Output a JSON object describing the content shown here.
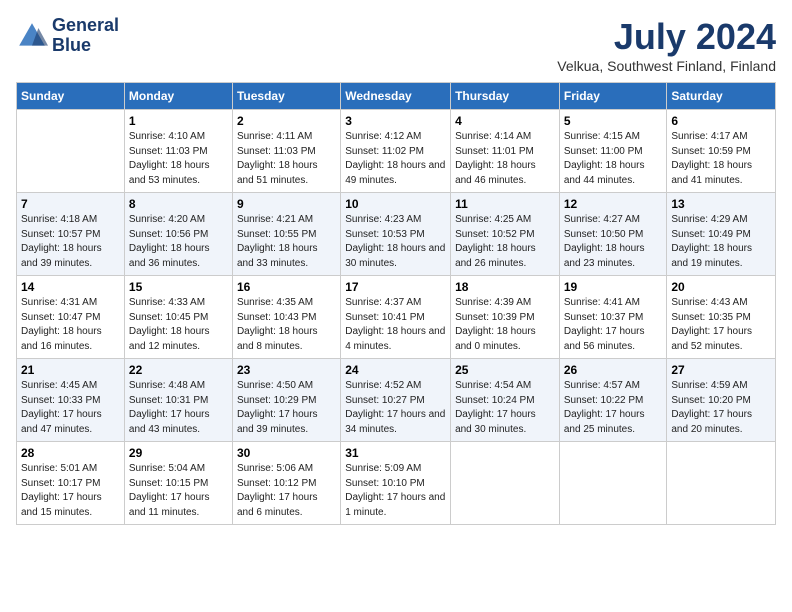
{
  "header": {
    "logo_line1": "General",
    "logo_line2": "Blue",
    "month": "July 2024",
    "location": "Velkua, Southwest Finland, Finland"
  },
  "weekdays": [
    "Sunday",
    "Monday",
    "Tuesday",
    "Wednesday",
    "Thursday",
    "Friday",
    "Saturday"
  ],
  "weeks": [
    [
      {
        "day": "",
        "info": ""
      },
      {
        "day": "1",
        "info": "Sunrise: 4:10 AM\nSunset: 11:03 PM\nDaylight: 18 hours\nand 53 minutes."
      },
      {
        "day": "2",
        "info": "Sunrise: 4:11 AM\nSunset: 11:03 PM\nDaylight: 18 hours\nand 51 minutes."
      },
      {
        "day": "3",
        "info": "Sunrise: 4:12 AM\nSunset: 11:02 PM\nDaylight: 18 hours\nand 49 minutes."
      },
      {
        "day": "4",
        "info": "Sunrise: 4:14 AM\nSunset: 11:01 PM\nDaylight: 18 hours\nand 46 minutes."
      },
      {
        "day": "5",
        "info": "Sunrise: 4:15 AM\nSunset: 11:00 PM\nDaylight: 18 hours\nand 44 minutes."
      },
      {
        "day": "6",
        "info": "Sunrise: 4:17 AM\nSunset: 10:59 PM\nDaylight: 18 hours\nand 41 minutes."
      }
    ],
    [
      {
        "day": "7",
        "info": "Sunrise: 4:18 AM\nSunset: 10:57 PM\nDaylight: 18 hours\nand 39 minutes."
      },
      {
        "day": "8",
        "info": "Sunrise: 4:20 AM\nSunset: 10:56 PM\nDaylight: 18 hours\nand 36 minutes."
      },
      {
        "day": "9",
        "info": "Sunrise: 4:21 AM\nSunset: 10:55 PM\nDaylight: 18 hours\nand 33 minutes."
      },
      {
        "day": "10",
        "info": "Sunrise: 4:23 AM\nSunset: 10:53 PM\nDaylight: 18 hours\nand 30 minutes."
      },
      {
        "day": "11",
        "info": "Sunrise: 4:25 AM\nSunset: 10:52 PM\nDaylight: 18 hours\nand 26 minutes."
      },
      {
        "day": "12",
        "info": "Sunrise: 4:27 AM\nSunset: 10:50 PM\nDaylight: 18 hours\nand 23 minutes."
      },
      {
        "day": "13",
        "info": "Sunrise: 4:29 AM\nSunset: 10:49 PM\nDaylight: 18 hours\nand 19 minutes."
      }
    ],
    [
      {
        "day": "14",
        "info": "Sunrise: 4:31 AM\nSunset: 10:47 PM\nDaylight: 18 hours\nand 16 minutes."
      },
      {
        "day": "15",
        "info": "Sunrise: 4:33 AM\nSunset: 10:45 PM\nDaylight: 18 hours\nand 12 minutes."
      },
      {
        "day": "16",
        "info": "Sunrise: 4:35 AM\nSunset: 10:43 PM\nDaylight: 18 hours\nand 8 minutes."
      },
      {
        "day": "17",
        "info": "Sunrise: 4:37 AM\nSunset: 10:41 PM\nDaylight: 18 hours\nand 4 minutes."
      },
      {
        "day": "18",
        "info": "Sunrise: 4:39 AM\nSunset: 10:39 PM\nDaylight: 18 hours\nand 0 minutes."
      },
      {
        "day": "19",
        "info": "Sunrise: 4:41 AM\nSunset: 10:37 PM\nDaylight: 17 hours\nand 56 minutes."
      },
      {
        "day": "20",
        "info": "Sunrise: 4:43 AM\nSunset: 10:35 PM\nDaylight: 17 hours\nand 52 minutes."
      }
    ],
    [
      {
        "day": "21",
        "info": "Sunrise: 4:45 AM\nSunset: 10:33 PM\nDaylight: 17 hours\nand 47 minutes."
      },
      {
        "day": "22",
        "info": "Sunrise: 4:48 AM\nSunset: 10:31 PM\nDaylight: 17 hours\nand 43 minutes."
      },
      {
        "day": "23",
        "info": "Sunrise: 4:50 AM\nSunset: 10:29 PM\nDaylight: 17 hours\nand 39 minutes."
      },
      {
        "day": "24",
        "info": "Sunrise: 4:52 AM\nSunset: 10:27 PM\nDaylight: 17 hours\nand 34 minutes."
      },
      {
        "day": "25",
        "info": "Sunrise: 4:54 AM\nSunset: 10:24 PM\nDaylight: 17 hours\nand 30 minutes."
      },
      {
        "day": "26",
        "info": "Sunrise: 4:57 AM\nSunset: 10:22 PM\nDaylight: 17 hours\nand 25 minutes."
      },
      {
        "day": "27",
        "info": "Sunrise: 4:59 AM\nSunset: 10:20 PM\nDaylight: 17 hours\nand 20 minutes."
      }
    ],
    [
      {
        "day": "28",
        "info": "Sunrise: 5:01 AM\nSunset: 10:17 PM\nDaylight: 17 hours\nand 15 minutes."
      },
      {
        "day": "29",
        "info": "Sunrise: 5:04 AM\nSunset: 10:15 PM\nDaylight: 17 hours\nand 11 minutes."
      },
      {
        "day": "30",
        "info": "Sunrise: 5:06 AM\nSunset: 10:12 PM\nDaylight: 17 hours\nand 6 minutes."
      },
      {
        "day": "31",
        "info": "Sunrise: 5:09 AM\nSunset: 10:10 PM\nDaylight: 17 hours\nand 1 minute."
      },
      {
        "day": "",
        "info": ""
      },
      {
        "day": "",
        "info": ""
      },
      {
        "day": "",
        "info": ""
      }
    ]
  ]
}
